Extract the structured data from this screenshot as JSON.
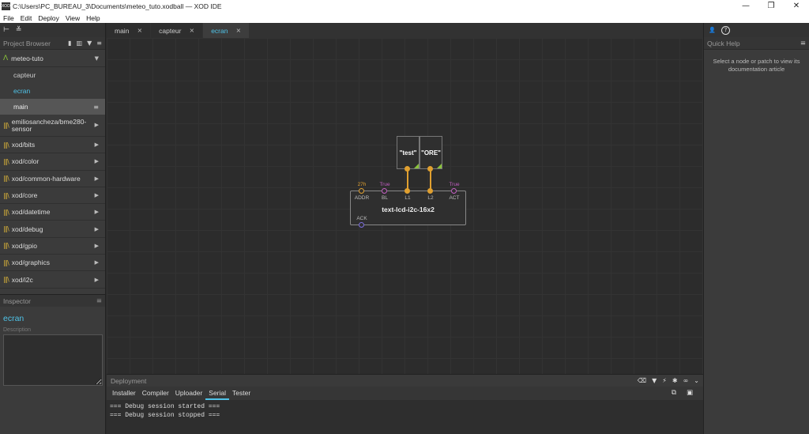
{
  "window": {
    "app_icon": "XOD",
    "title": "C:\\Users\\PC_BUREAU_3\\Documents\\meteo_tuto.xodball — XOD IDE",
    "controls": [
      "—",
      "❐",
      "✕"
    ]
  },
  "menu": [
    "File",
    "Edit",
    "Deploy",
    "View",
    "Help"
  ],
  "project_browser": {
    "title": "Project Browser",
    "project": "meteo-tuto",
    "patches": [
      "capteur",
      "ecran",
      "main"
    ],
    "libraries": [
      "emiliosancheza/bme280-sensor",
      "xod/bits",
      "xod/color",
      "xod/common-hardware",
      "xod/core",
      "xod/datetime",
      "xod/debug",
      "xod/gpio",
      "xod/graphics",
      "xod/i2c"
    ]
  },
  "inspector": {
    "title": "Inspector",
    "name": "ecran",
    "description_label": "Description",
    "description": ""
  },
  "tabs": [
    {
      "label": "main",
      "close": "×"
    },
    {
      "label": "capteur",
      "close": "×"
    },
    {
      "label": "ecran",
      "close": "×"
    }
  ],
  "canvas": {
    "const_nodes": [
      "\"test\"",
      "\"ORE\""
    ],
    "lcd_node": {
      "label": "text-lcd-i2c-16x2",
      "inputs": [
        {
          "name": "ADDR",
          "value": "27h",
          "value_color": "#e0a030"
        },
        {
          "name": "BL",
          "value": "True",
          "value_color": "#c25ec2"
        },
        {
          "name": "L1",
          "value": ""
        },
        {
          "name": "L2",
          "value": ""
        },
        {
          "name": "ACT",
          "value": "True",
          "value_color": "#c25ec2"
        }
      ],
      "output": "ACK"
    }
  },
  "quick_help": {
    "title": "Quick Help",
    "text": "Select a node or patch to view its documentation article"
  },
  "deployment": {
    "title": "Deployment",
    "tabs": [
      "Installer",
      "Compiler",
      "Uploader",
      "Serial",
      "Tester"
    ],
    "active_tab": "Serial",
    "console": [
      "=== Debug session started ===",
      "=== Debug session stopped ==="
    ]
  }
}
